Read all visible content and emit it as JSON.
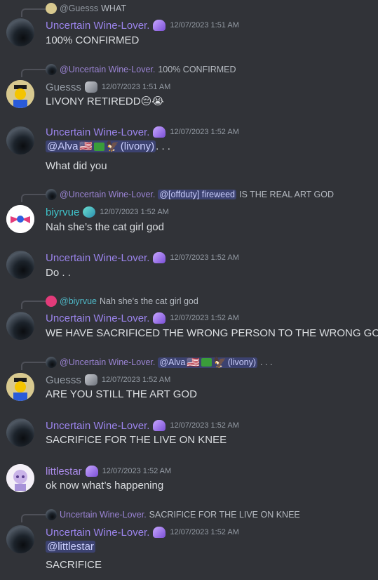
{
  "messages": [
    {
      "reply": {
        "name": "@Guesss",
        "text": "WHAT"
      },
      "author": "Uncertain Wine-Lover.",
      "time": "12/07/2023 1:51 AM",
      "lines": [
        "100% CONFIRMED"
      ]
    },
    {
      "reply": {
        "name": "@Uncertain Wine-Lover.",
        "text": "100% CONFIRMED"
      },
      "author": "Guesss",
      "time": "12/07/2023 1:51 AM",
      "lines": [
        "LIVONY RETIREDD"
      ],
      "emoji": "😔😭"
    },
    {
      "author": "Uncertain Wine-Lover.",
      "time": "12/07/2023 1:52 AM",
      "mention": "@Alva",
      "mention_suffix": "(livony)",
      "after_mention": " . . .",
      "lines": [
        "What did you"
      ]
    },
    {
      "reply": {
        "name": "@Uncertain Wine-Lover.",
        "mention": "@[offduty] fireweed",
        "text": "IS THE REAL ART GOD"
      },
      "author": "biyrvue",
      "time": "12/07/2023 1:52 AM",
      "lines": [
        "Nah she’s the cat girl god"
      ]
    },
    {
      "author": "Uncertain Wine-Lover.",
      "time": "12/07/2023 1:52 AM",
      "lines": [
        "Do . ."
      ]
    },
    {
      "reply": {
        "name": "@biyrvue",
        "text": "Nah she’s the cat girl god"
      },
      "author": "Uncertain Wine-Lover.",
      "time": "12/07/2023 1:52 AM",
      "lines": [
        "WE HAVE SACRIFICED THE WRONG PERSON TO THE WRONG GOD"
      ]
    },
    {
      "reply": {
        "name": "@Uncertain Wine-Lover.",
        "mention": "@Alva",
        "mention_suffix": "(livony)",
        "text": ". . ."
      },
      "author": "Guesss",
      "time": "12/07/2023 1:52 AM",
      "lines": [
        "ARE YOU STILL THE ART GOD"
      ]
    },
    {
      "author": "Uncertain Wine-Lover.",
      "time": "12/07/2023 1:52 AM",
      "lines": [
        "SACRIFICE FOR THE LIVE ON KNEE"
      ]
    },
    {
      "author": "littlestar",
      "time": "12/07/2023 1:52 AM",
      "lines": [
        "ok now what’s happening"
      ]
    },
    {
      "reply": {
        "name": "Uncertain Wine-Lover.",
        "text": "SACRIFICE FOR THE LIVE ON KNEE"
      },
      "author": "Uncertain Wine-Lover.",
      "time": "12/07/2023 1:52 AM",
      "mention": "@littlestar",
      "lines": [
        "SACRIFICE"
      ]
    }
  ],
  "emoji": {
    "flag": "🇺🇸",
    "bird": "🦅"
  },
  "colors": {
    "background": "#313338",
    "wine": "#9b84ec",
    "guess": "#949ba4",
    "biy": "#3fc2c9",
    "mention_bg": "#3c4270"
  }
}
